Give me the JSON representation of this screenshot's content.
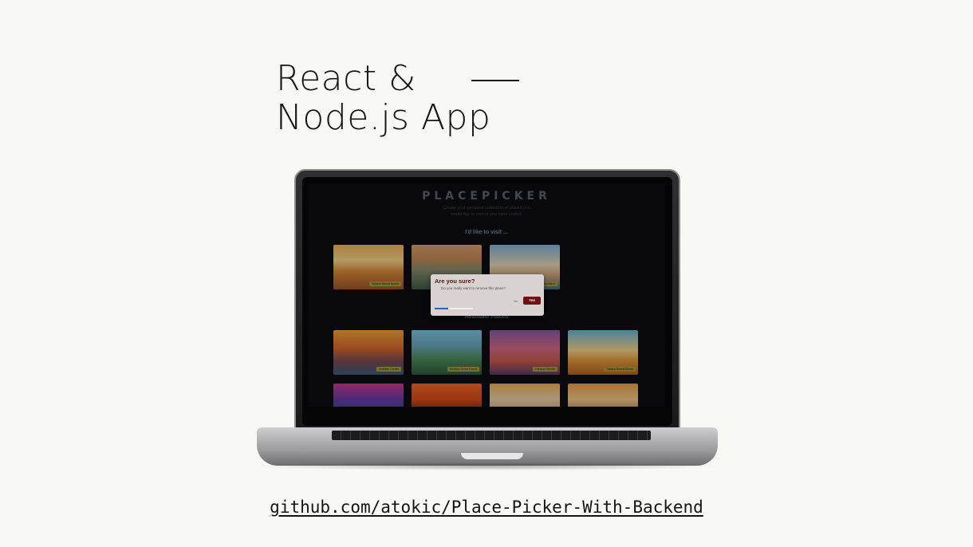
{
  "headline": {
    "line1": "React &",
    "line2": "Node.js App"
  },
  "app": {
    "title": "PLACEPICKER",
    "subtitle_line1": "Create your personal collection of places you",
    "subtitle_line2": "would like to visit or you have visited.",
    "wishlist_title": "I'd like to visit ...",
    "available_title": "Available Places",
    "wishlist_places": [
      "Sahara Desert Dunes",
      "",
      "Taj Mahal"
    ],
    "available_places": [
      "Venetian Canals",
      "Bamboo Grove Forest",
      "Parisian Streets",
      "Sahara Desert Dunes"
    ]
  },
  "modal": {
    "title": "Are you sure?",
    "text": "Do you really want to remove this place?",
    "no_label": "No",
    "yes_label": "Yes",
    "progress": 0.35
  },
  "colors": {
    "accent": "#6e1313",
    "progress": "#2c5fd1",
    "background": "#f8f8f4"
  },
  "footer": {
    "link_text": "github.com/atokic/Place-Picker-With-Backend"
  }
}
